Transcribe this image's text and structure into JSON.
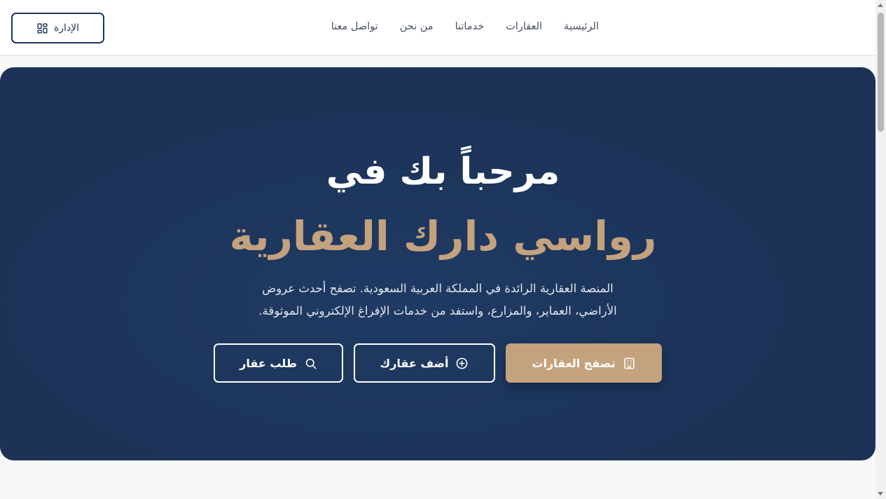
{
  "header": {
    "admin_label": "الإدارة",
    "nav": [
      "الرئيسية",
      "العقارات",
      "خدماتنا",
      "من نحن",
      "تواصل معنا"
    ]
  },
  "hero": {
    "title": "مرحباً بك في",
    "subtitle": "رواسي دارك العقارية",
    "description_line1": "المنصة العقارية الرائدة في المملكة العربية السعودية. تصفح أحدث عروض",
    "description_line2": "الأراضي، العماير، والمزارع، واستفد من خدمات الإفراغ الإلكتروني الموثوقة.",
    "buttons": {
      "browse": "تصفح العقارات",
      "add": "أضف عقارك",
      "request": "طلب عقار"
    }
  },
  "colors": {
    "navy": "#1e355a",
    "gold": "#c4a27e",
    "background": "#f7f8fa"
  },
  "icons": {
    "admin": "dashboard-grid-icon",
    "browse": "building-icon",
    "add": "plus-circle-icon",
    "request": "search-icon"
  }
}
